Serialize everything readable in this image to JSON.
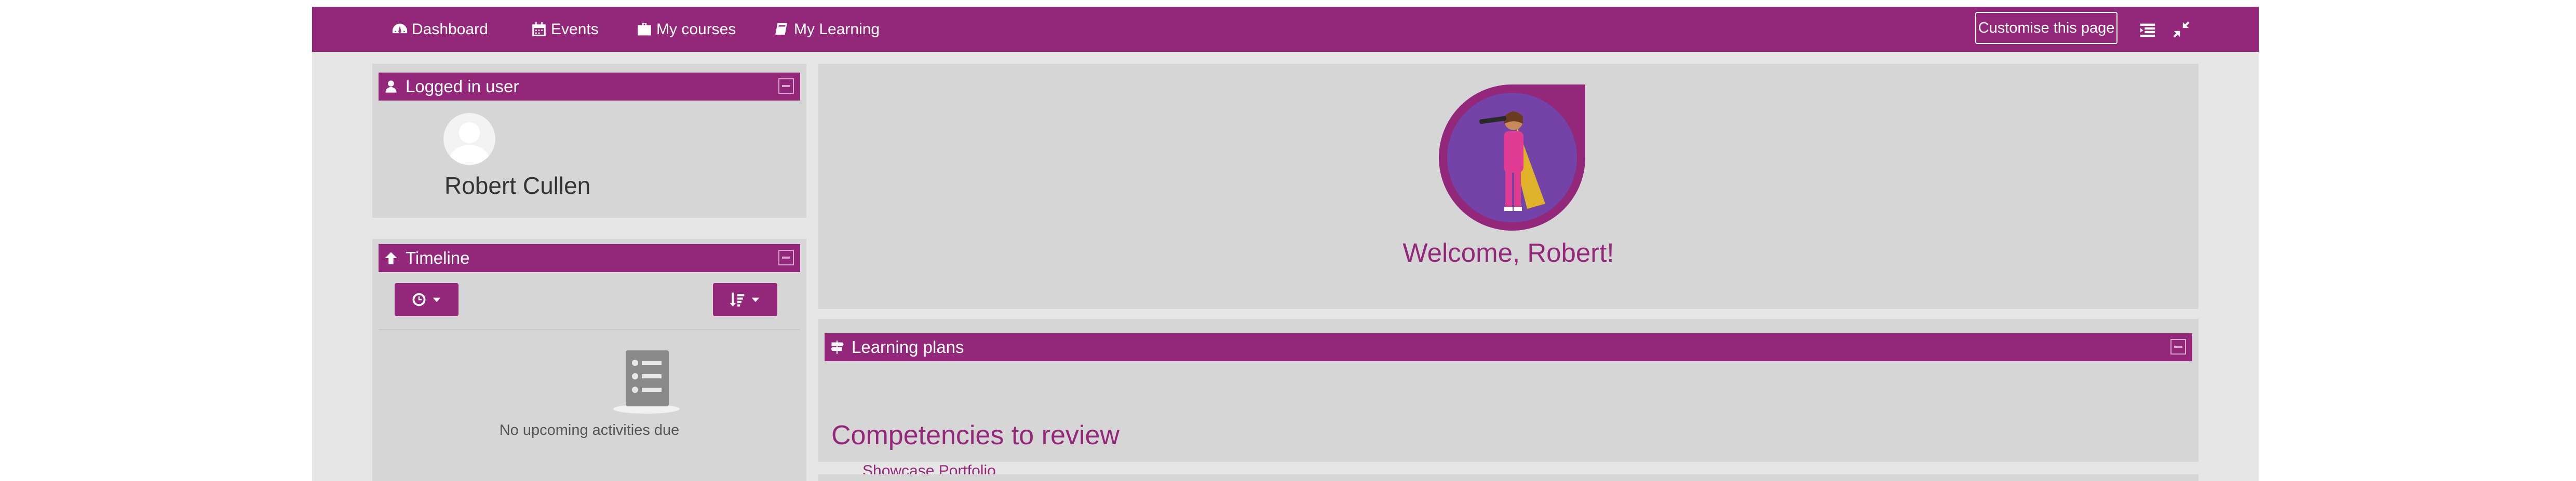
{
  "navbar": {
    "items": [
      {
        "label": "Dashboard",
        "icon": "dashboard-icon"
      },
      {
        "label": "Events",
        "icon": "calendar-icon"
      },
      {
        "label": "My courses",
        "icon": "briefcase-icon"
      },
      {
        "label": "My Learning",
        "icon": "book-icon"
      }
    ],
    "customise_label": "Customise this page",
    "right_icons": [
      "block-list-icon",
      "collapse-arrows-icon"
    ]
  },
  "logged_in_block": {
    "title": "Logged in user",
    "icon": "user-icon",
    "user_name": "Robert Cullen"
  },
  "timeline_block": {
    "title": "Timeline",
    "icon": "arrow-up-icon",
    "filter_icon": "clock-icon",
    "sort_icon": "sort-icon",
    "empty_text": "No upcoming activities due"
  },
  "welcome_block": {
    "greeting": "Welcome, Robert!"
  },
  "learning_plans_block": {
    "title": "Learning plans",
    "icon": "signpost-icon",
    "heading": "Competencies to review",
    "link": "Showcase Portfolio"
  },
  "colors": {
    "brand": "#93287a",
    "page_bg": "#e6e6e6",
    "card_bg": "#d6d6d6"
  }
}
